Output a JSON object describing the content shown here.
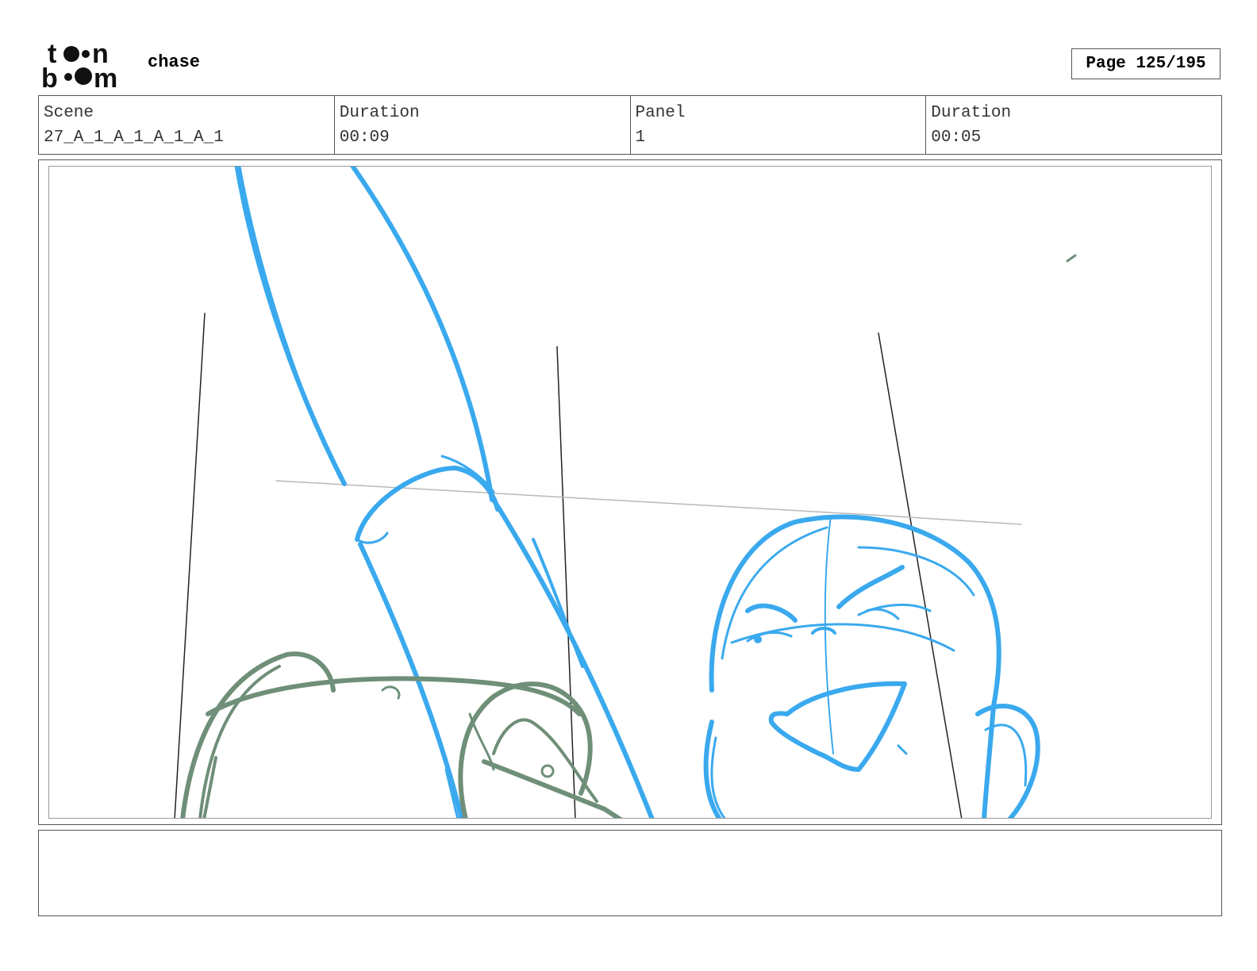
{
  "header": {
    "logo_text": "toon boom",
    "project_title": "chase",
    "page_label": "Page 125/195"
  },
  "info": {
    "scene_label": "Scene",
    "scene_value": "27_A_1_A_1_A_1_A_1",
    "scene_duration_label": "Duration",
    "scene_duration_value": "00:09",
    "panel_label": "Panel",
    "panel_value": "1",
    "panel_duration_label": "Duration",
    "panel_duration_value": "00:05"
  },
  "colors": {
    "sketch_blue": "#3aa9ee",
    "sketch_green": "#6f8f78",
    "guide_dark": "#222222",
    "guide_light": "#b8b8b8"
  },
  "notes": ""
}
